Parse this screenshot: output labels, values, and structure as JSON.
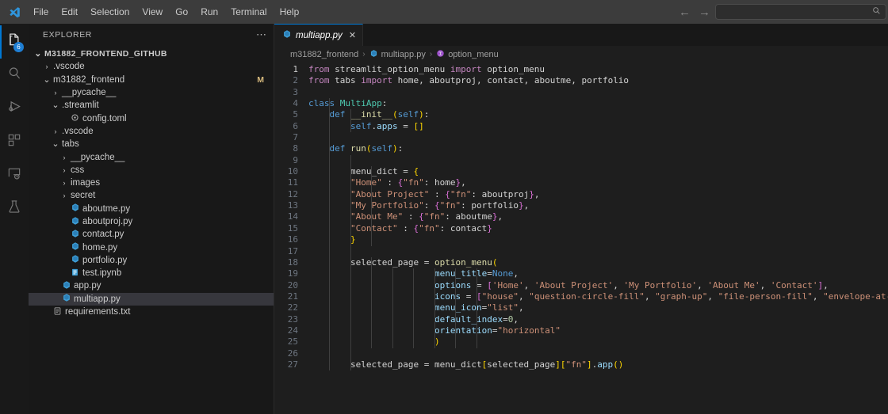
{
  "titlebar": {
    "logo_icon": "vscode-logo-icon",
    "menus": [
      "File",
      "Edit",
      "Selection",
      "View",
      "Go",
      "Run",
      "Terminal",
      "Help"
    ],
    "back_icon": "arrow-left-icon",
    "forward_icon": "arrow-right-icon",
    "command_center_value": "",
    "command_center_placeholder": "",
    "command_center_icon": "search-icon"
  },
  "activitybar": {
    "items": [
      {
        "name": "explorer",
        "icon": "files-icon",
        "badge": "6",
        "active": true
      },
      {
        "name": "search",
        "icon": "search-icon",
        "badge": "",
        "active": false
      },
      {
        "name": "run-and-debug",
        "icon": "run-debug-icon",
        "badge": "",
        "active": false
      },
      {
        "name": "extensions",
        "icon": "extensions-icon",
        "badge": "",
        "active": false
      },
      {
        "name": "remote-explorer",
        "icon": "remote-explorer-icon",
        "badge": "",
        "active": false
      },
      {
        "name": "testing",
        "icon": "beaker-icon",
        "badge": "",
        "active": false
      }
    ]
  },
  "sidebar": {
    "title": "EXPLORER",
    "more_actions_icon": "ellipsis-icon",
    "tree": [
      {
        "label": "M31882_FRONTEND_GITHUB",
        "depth": 0,
        "kind": "root",
        "expanded": true,
        "icon": "",
        "badge": ""
      },
      {
        "label": ".vscode",
        "depth": 1,
        "kind": "folder",
        "expanded": false,
        "icon": "",
        "badge": ""
      },
      {
        "label": "m31882_frontend",
        "depth": 1,
        "kind": "folder",
        "expanded": true,
        "icon": "",
        "badge": "M"
      },
      {
        "label": "__pycache__",
        "depth": 2,
        "kind": "folder",
        "expanded": false,
        "icon": "",
        "badge": ""
      },
      {
        "label": ".streamlit",
        "depth": 2,
        "kind": "folder",
        "expanded": true,
        "icon": "",
        "badge": ""
      },
      {
        "label": "config.toml",
        "depth": 3,
        "kind": "file",
        "expanded": false,
        "icon": "toml-icon",
        "badge": ""
      },
      {
        "label": ".vscode",
        "depth": 2,
        "kind": "folder",
        "expanded": false,
        "icon": "",
        "badge": ""
      },
      {
        "label": "tabs",
        "depth": 2,
        "kind": "folder",
        "expanded": true,
        "icon": "",
        "badge": ""
      },
      {
        "label": "__pycache__",
        "depth": 3,
        "kind": "folder",
        "expanded": false,
        "icon": "",
        "badge": ""
      },
      {
        "label": "css",
        "depth": 3,
        "kind": "folder",
        "expanded": false,
        "icon": "",
        "badge": ""
      },
      {
        "label": "images",
        "depth": 3,
        "kind": "folder",
        "expanded": false,
        "icon": "",
        "badge": ""
      },
      {
        "label": "secret",
        "depth": 3,
        "kind": "folder",
        "expanded": false,
        "icon": "",
        "badge": ""
      },
      {
        "label": "aboutme.py",
        "depth": 3,
        "kind": "file",
        "expanded": false,
        "icon": "python-icon",
        "badge": ""
      },
      {
        "label": "aboutproj.py",
        "depth": 3,
        "kind": "file",
        "expanded": false,
        "icon": "python-icon",
        "badge": ""
      },
      {
        "label": "contact.py",
        "depth": 3,
        "kind": "file",
        "expanded": false,
        "icon": "python-icon",
        "badge": ""
      },
      {
        "label": "home.py",
        "depth": 3,
        "kind": "file",
        "expanded": false,
        "icon": "python-icon",
        "badge": ""
      },
      {
        "label": "portfolio.py",
        "depth": 3,
        "kind": "file",
        "expanded": false,
        "icon": "python-icon",
        "badge": ""
      },
      {
        "label": "test.ipynb",
        "depth": 3,
        "kind": "file",
        "expanded": false,
        "icon": "notebook-icon",
        "badge": ""
      },
      {
        "label": "app.py",
        "depth": 2,
        "kind": "file",
        "expanded": false,
        "icon": "python-icon",
        "badge": ""
      },
      {
        "label": "multiapp.py",
        "depth": 2,
        "kind": "file",
        "expanded": false,
        "icon": "python-icon",
        "badge": "",
        "selected": true
      },
      {
        "label": "requirements.txt",
        "depth": 1,
        "kind": "file",
        "expanded": false,
        "icon": "text-icon",
        "badge": ""
      }
    ]
  },
  "editor": {
    "tab": {
      "label": "multiapp.py",
      "icon": "python-icon",
      "close_icon": "close-icon",
      "preview": true
    },
    "breadcrumb": [
      {
        "label": "m31882_frontend",
        "icon": ""
      },
      {
        "label": "multiapp.py",
        "icon": "python-icon"
      },
      {
        "label": "option_menu",
        "icon": "symbol-variable-icon"
      }
    ],
    "breadcrumb_separator": "›",
    "lines": [
      {
        "n": 1,
        "text": "from streamlit_option_menu import option_menu"
      },
      {
        "n": 2,
        "text": "from tabs import home, aboutproj, contact, aboutme, portfolio"
      },
      {
        "n": 3,
        "text": ""
      },
      {
        "n": 4,
        "text": "class MultiApp:"
      },
      {
        "n": 5,
        "text": "    def __init__(self):"
      },
      {
        "n": 6,
        "text": "        self.apps = []"
      },
      {
        "n": 7,
        "text": ""
      },
      {
        "n": 8,
        "text": "    def run(self):"
      },
      {
        "n": 9,
        "text": ""
      },
      {
        "n": 10,
        "text": "        menu_dict = {"
      },
      {
        "n": 11,
        "text": "        \"Home\" : {\"fn\": home},"
      },
      {
        "n": 12,
        "text": "        \"About Project\" : {\"fn\": aboutproj},"
      },
      {
        "n": 13,
        "text": "        \"My Portfolio\": {\"fn\": portfolio},"
      },
      {
        "n": 14,
        "text": "        \"About Me\" : {\"fn\": aboutme},"
      },
      {
        "n": 15,
        "text": "        \"Contact\" : {\"fn\": contact}"
      },
      {
        "n": 16,
        "text": "        }"
      },
      {
        "n": 17,
        "text": ""
      },
      {
        "n": 18,
        "text": "        selected_page = option_menu("
      },
      {
        "n": 19,
        "text": "                        menu_title=None,"
      },
      {
        "n": 20,
        "text": "                        options = ['Home', 'About Project', 'My Portfolio', 'About Me', 'Contact'],"
      },
      {
        "n": 21,
        "text": "                        icons = [\"house\", \"question-circle-fill\", \"graph-up\", \"file-person-fill\", \"envelope-at-fill\"],"
      },
      {
        "n": 22,
        "text": "                        menu_icon=\"list\","
      },
      {
        "n": 23,
        "text": "                        default_index=0,"
      },
      {
        "n": 24,
        "text": "                        orientation=\"horizontal\""
      },
      {
        "n": 25,
        "text": "                        )"
      },
      {
        "n": 26,
        "text": ""
      },
      {
        "n": 27,
        "text": "        selected_page = menu_dict[selected_page][\"fn\"].app()"
      }
    ]
  },
  "colors": {
    "accent": "#0078d4",
    "editor_bg": "#1e1e1e",
    "sidebar_bg": "#181818",
    "titlebar_bg": "#3c3c3c",
    "selection_bg": "#37373d",
    "keyword": "#569cd6",
    "control": "#c586c0",
    "string": "#ce9178",
    "function": "#dcdcaa",
    "class": "#4ec9b0",
    "variable": "#9cdcfe",
    "bracket1": "#ffd700",
    "bracket2": "#da70d6",
    "modified": "#d7ba7d"
  }
}
